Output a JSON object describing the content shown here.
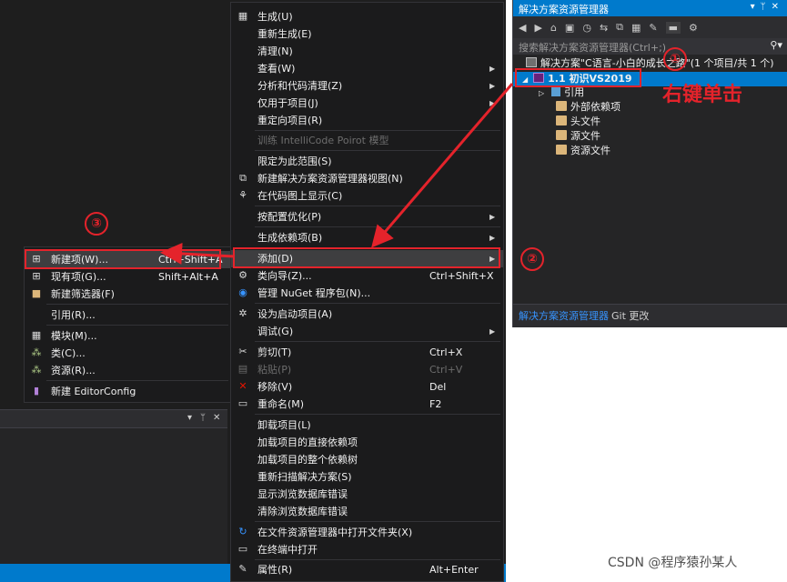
{
  "solution_explorer": {
    "title": "解决方案资源管理器",
    "search_placeholder": "搜索解决方案资源管理器(Ctrl+;)",
    "solution_line": "解决方案\"C语言-小白的成长之路\"(1 个项目/共 1 个)",
    "project": "1.1  初识VS2019",
    "children": [
      "引用",
      "外部依赖项",
      "头文件",
      "源文件",
      "资源文件"
    ],
    "tabs": [
      "解决方案资源管理器",
      "Git 更改"
    ]
  },
  "context_menu": {
    "items": [
      {
        "label": "生成(U)",
        "icon": "build-icon"
      },
      {
        "label": "重新生成(E)"
      },
      {
        "label": "清理(N)"
      },
      {
        "label": "查看(W)",
        "submenu": true
      },
      {
        "label": "分析和代码清理(Z)",
        "submenu": true
      },
      {
        "label": "仅用于项目(J)",
        "submenu": true
      },
      {
        "label": "重定向项目(R)"
      },
      {
        "label": "训练 IntelliCode Poirot 模型",
        "disabled": true
      },
      {
        "label": "限定为此范围(S)"
      },
      {
        "label": "新建解决方案资源管理器视图(N)",
        "icon": "new-view-icon"
      },
      {
        "label": "在代码图上显示(C)",
        "icon": "code-map-icon"
      },
      {
        "label": "按配置优化(P)",
        "submenu": true
      },
      {
        "label": "生成依赖项(B)",
        "submenu": true
      },
      {
        "label": "添加(D)",
        "submenu": true
      },
      {
        "label": "类向导(Z)...",
        "shortcut": "Ctrl+Shift+X",
        "icon": "class-wizard-icon"
      },
      {
        "label": "管理 NuGet 程序包(N)...",
        "icon": "nuget-icon"
      },
      {
        "label": "设为启动项目(A)",
        "icon": "gear-icon"
      },
      {
        "label": "调试(G)",
        "submenu": true
      },
      {
        "label": "剪切(T)",
        "shortcut": "Ctrl+X",
        "icon": "cut-icon"
      },
      {
        "label": "粘贴(P)",
        "shortcut": "Ctrl+V",
        "disabled": true,
        "icon": "paste-icon"
      },
      {
        "label": "移除(V)",
        "shortcut": "Del",
        "icon": "remove-icon"
      },
      {
        "label": "重命名(M)",
        "shortcut": "F2",
        "icon": "rename-icon"
      },
      {
        "label": "卸载项目(L)"
      },
      {
        "label": "加载项目的直接依赖项"
      },
      {
        "label": "加载项目的整个依赖树"
      },
      {
        "label": "重新扫描解决方案(S)"
      },
      {
        "label": "显示浏览数据库错误"
      },
      {
        "label": "清除浏览数据库错误"
      },
      {
        "label": "在文件资源管理器中打开文件夹(X)",
        "icon": "open-folder-icon"
      },
      {
        "label": "在终端中打开",
        "icon": "terminal-icon"
      },
      {
        "label": "属性(R)",
        "shortcut": "Alt+Enter",
        "icon": "wrench-icon"
      }
    ]
  },
  "add_submenu": {
    "items": [
      {
        "label": "新建项(W)...",
        "shortcut": "Ctrl+Shift+A"
      },
      {
        "label": "现有项(G)...",
        "shortcut": "Shift+Alt+A"
      },
      {
        "label": "新建筛选器(F)"
      },
      {
        "label": "引用(R)..."
      },
      {
        "label": "模块(M)..."
      },
      {
        "label": "类(C)..."
      },
      {
        "label": "资源(R)..."
      },
      {
        "label": "新建 EditorConfig"
      }
    ]
  },
  "annotations": {
    "step1": "①",
    "step2": "②",
    "step3": "③",
    "right_click_text": "右键单击"
  },
  "watermark": "CSDN @程序猿孙某人",
  "colors": {
    "accent": "#007acc",
    "annotation": "#e4232b",
    "menu_bg": "#1b1b1c"
  }
}
